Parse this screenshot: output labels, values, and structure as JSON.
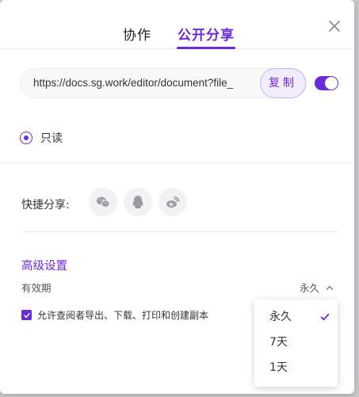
{
  "tabs": [
    {
      "label": "协作"
    },
    {
      "label": "公开分享"
    }
  ],
  "link": {
    "url": "https://docs.sg.work/editor/document?file_",
    "copy_label": "复制"
  },
  "permission": {
    "label": "只读"
  },
  "share": {
    "label": "快捷分享:"
  },
  "advanced": {
    "title": "高级设置",
    "validity_label": "有效期",
    "validity_value": "永久",
    "allow_label": "允许查阅者导出、下载、打印和创建副本"
  },
  "dropdown": {
    "options": [
      "永久",
      "7天",
      "1天"
    ]
  },
  "colors": {
    "accent": "#6b2bd9"
  }
}
